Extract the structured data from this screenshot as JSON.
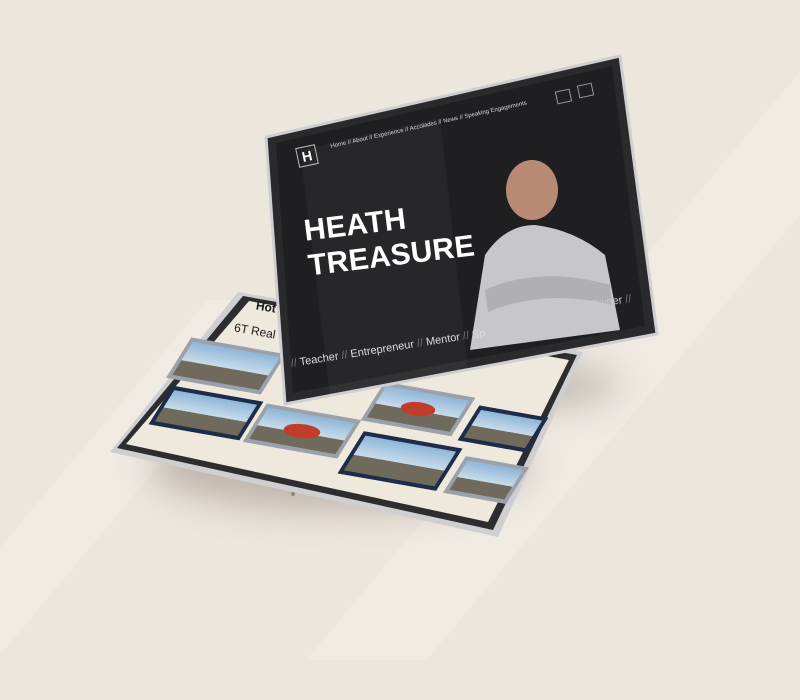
{
  "front_site": {
    "brand_mark": "H",
    "nav": [
      "Home",
      "About",
      "Experience",
      "Accolades",
      "News",
      "Speaking Engagements"
    ],
    "hero_title_line1": "HEATH",
    "hero_title_line2": "TREASURE",
    "roles": [
      "Teacher",
      "Entrepreneur",
      "Mentor",
      "Sp"
    ],
    "roles_tail": "Owner",
    "icons": [
      "mail-icon",
      "phone-icon"
    ]
  },
  "back_site": {
    "title": "Hot",
    "subtitle": "6T Real"
  },
  "colors": {
    "background": "#ede6dd",
    "front_screen": "#1f1f21",
    "back_screen": "#efe8dc",
    "thumb_frame": "#20304f"
  }
}
